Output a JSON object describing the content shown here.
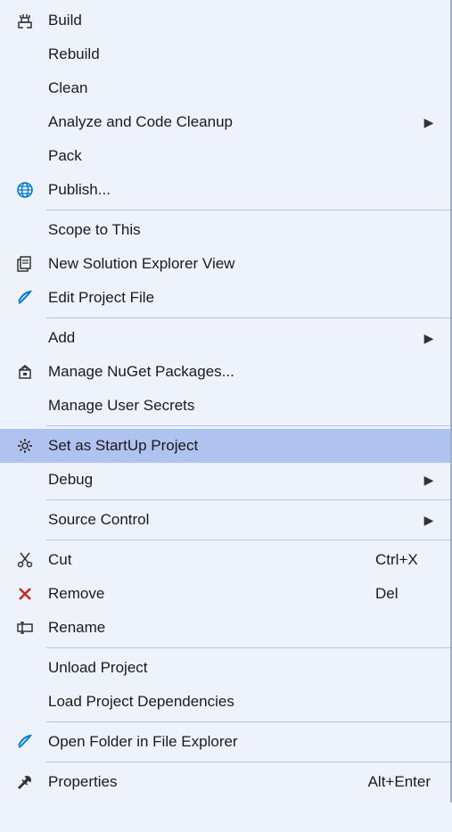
{
  "menu": {
    "items": [
      {
        "label": "Build",
        "icon": "build-icon",
        "submenu": false,
        "shortcut": "",
        "highlighted": false
      },
      {
        "label": "Rebuild",
        "icon": "",
        "submenu": false,
        "shortcut": "",
        "highlighted": false
      },
      {
        "label": "Clean",
        "icon": "",
        "submenu": false,
        "shortcut": "",
        "highlighted": false
      },
      {
        "label": "Analyze and Code Cleanup",
        "icon": "",
        "submenu": true,
        "shortcut": "",
        "highlighted": false
      },
      {
        "label": "Pack",
        "icon": "",
        "submenu": false,
        "shortcut": "",
        "highlighted": false
      },
      {
        "label": "Publish...",
        "icon": "publish-icon",
        "submenu": false,
        "shortcut": "",
        "highlighted": false
      },
      {
        "separator": true
      },
      {
        "label": "Scope to This",
        "icon": "",
        "submenu": false,
        "shortcut": "",
        "highlighted": false
      },
      {
        "label": "New Solution Explorer View",
        "icon": "solution-view-icon",
        "submenu": false,
        "shortcut": "",
        "highlighted": false
      },
      {
        "label": "Edit Project File",
        "icon": "edit-icon",
        "submenu": false,
        "shortcut": "",
        "highlighted": false
      },
      {
        "separator": true
      },
      {
        "label": "Add",
        "icon": "",
        "submenu": true,
        "shortcut": "",
        "highlighted": false
      },
      {
        "label": "Manage NuGet Packages...",
        "icon": "nuget-icon",
        "submenu": false,
        "shortcut": "",
        "highlighted": false
      },
      {
        "label": "Manage User Secrets",
        "icon": "",
        "submenu": false,
        "shortcut": "",
        "highlighted": false
      },
      {
        "separator": true
      },
      {
        "label": "Set as StartUp Project",
        "icon": "gear-icon",
        "submenu": false,
        "shortcut": "",
        "highlighted": true
      },
      {
        "label": "Debug",
        "icon": "",
        "submenu": true,
        "shortcut": "",
        "highlighted": false
      },
      {
        "separator": true
      },
      {
        "label": "Source Control",
        "icon": "",
        "submenu": true,
        "shortcut": "",
        "highlighted": false
      },
      {
        "separator": true
      },
      {
        "label": "Cut",
        "icon": "cut-icon",
        "submenu": false,
        "shortcut": "Ctrl+X",
        "highlighted": false
      },
      {
        "label": "Remove",
        "icon": "remove-icon",
        "submenu": false,
        "shortcut": "Del",
        "highlighted": false
      },
      {
        "label": "Rename",
        "icon": "rename-icon",
        "submenu": false,
        "shortcut": "",
        "highlighted": false
      },
      {
        "separator": true
      },
      {
        "label": "Unload Project",
        "icon": "",
        "submenu": false,
        "shortcut": "",
        "highlighted": false
      },
      {
        "label": "Load Project Dependencies",
        "icon": "",
        "submenu": false,
        "shortcut": "",
        "highlighted": false
      },
      {
        "separator": true
      },
      {
        "label": "Open Folder in File Explorer",
        "icon": "open-folder-icon",
        "submenu": false,
        "shortcut": "",
        "highlighted": false
      },
      {
        "separator": true
      },
      {
        "label": "Properties",
        "icon": "properties-icon",
        "submenu": false,
        "shortcut": "Alt+Enter",
        "highlighted": false
      }
    ]
  }
}
